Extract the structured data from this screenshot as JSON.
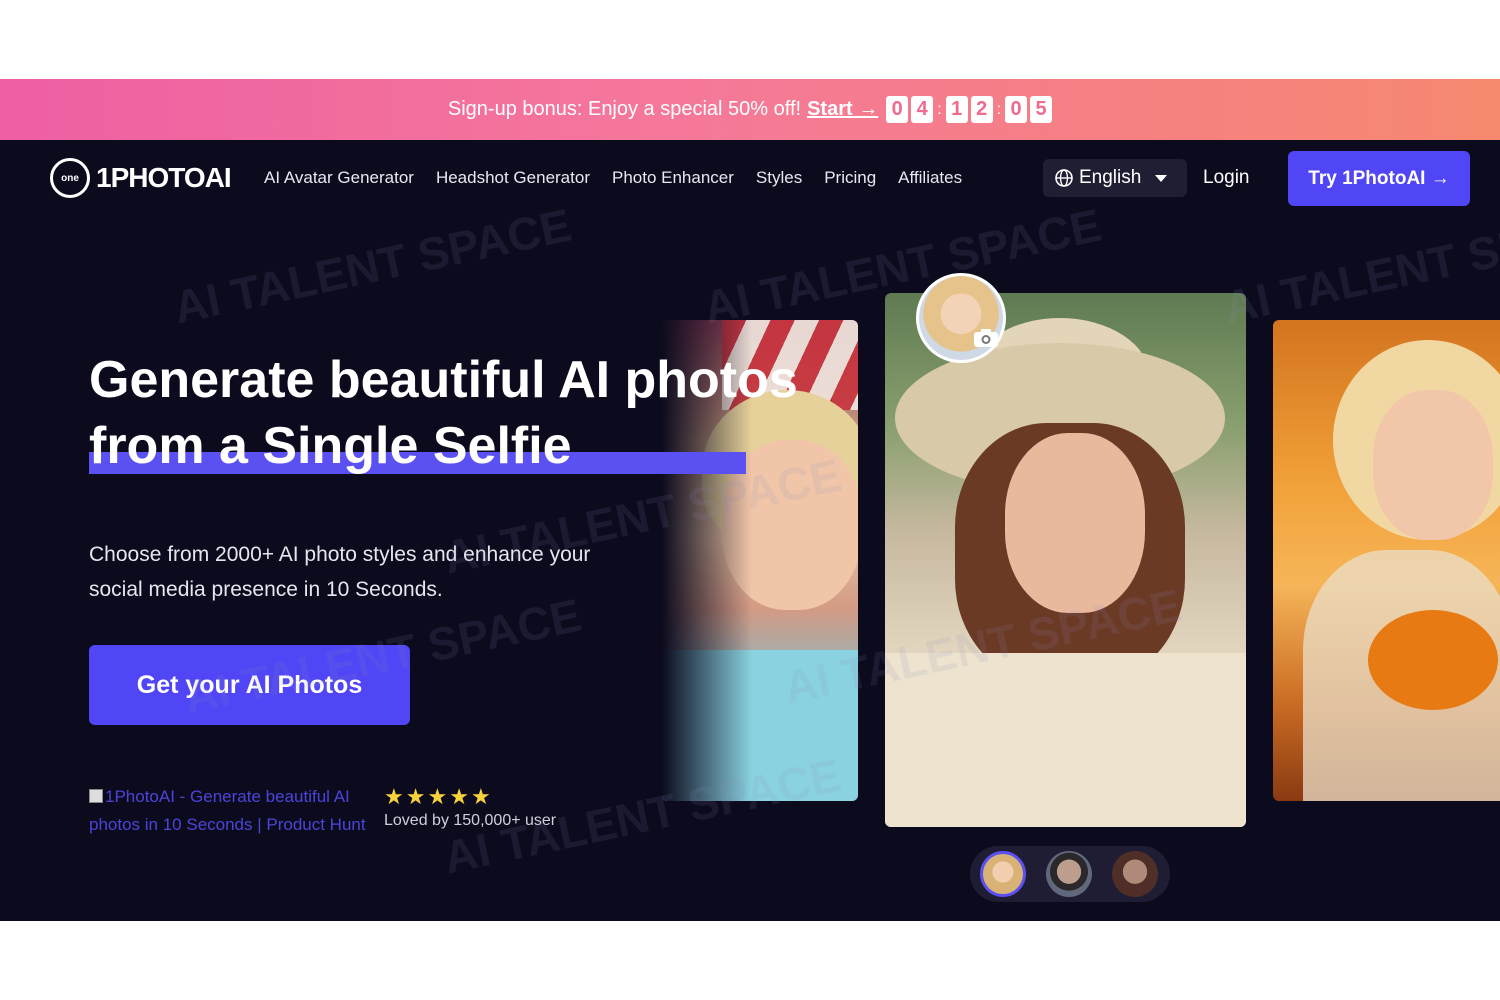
{
  "promo": {
    "message": "Sign-up bonus: Enjoy a special 50% off!",
    "start_link": "Start →",
    "timer_digits": [
      "0",
      "4",
      "1",
      "2",
      "0",
      "5"
    ]
  },
  "nav": {
    "logo_mark": "one",
    "logo_text": "1PHOTOAI",
    "links": [
      "AI Avatar Generator",
      "Headshot Generator",
      "Photo Enhancer",
      "Styles",
      "Pricing",
      "Affiliates"
    ],
    "language": "English",
    "login": "Login",
    "cta": "Try 1PhotoAI →"
  },
  "hero": {
    "title_line1": "Generate beautiful AI photos",
    "title_line2": "from a Single Selfie",
    "subtitle": "Choose from 2000+ AI photo styles and enhance your social media presence in 10 Seconds.",
    "cta": "Get your AI Photos",
    "producthunt_alt": "1PhotoAI - Generate beautiful AI photos in 10 Seconds | Product Hunt",
    "rating_stars": 5,
    "loved_by": "Loved by 150,000+ user"
  },
  "watermark": "AI TALENT SPACE",
  "colors": {
    "accent": "#5046f5",
    "background": "#0c0b1e",
    "promo_start": "#ee5fa3",
    "promo_end": "#f6886f",
    "star": "#f7d23b"
  },
  "icons": {
    "language": "globe-icon",
    "language_caret": "chevron-down-icon",
    "camera": "camera-icon",
    "rating": "star-icon"
  }
}
